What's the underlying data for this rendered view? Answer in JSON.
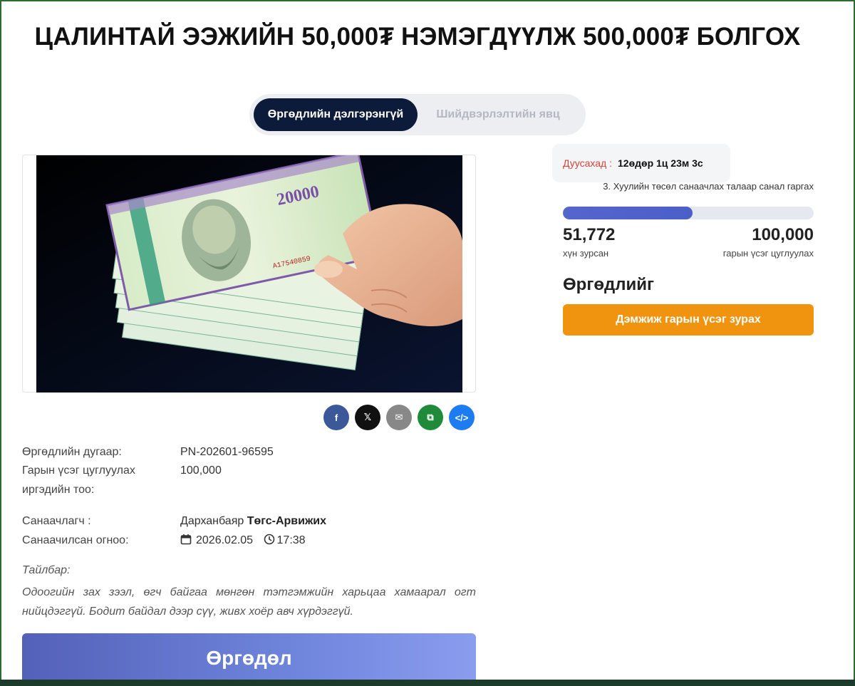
{
  "title": "ЦАЛИНТАЙ ЭЭЖИЙН 50,000₮ НЭМЭГДҮҮЛЖ 500,000₮ БОЛГОХ",
  "tabs": [
    {
      "label": "Өргөдлийн дэлгэрэнгүй",
      "active": true
    },
    {
      "label": "Шийдвэрлэлтийн явц",
      "active": false
    }
  ],
  "share": [
    "facebook-icon",
    "x-icon",
    "email-icon",
    "copy-icon",
    "embed-icon"
  ],
  "details": {
    "number_label": "Өргөдлийн дугаар:",
    "number_value": "PN-202601-96595",
    "target_label_line1": "Гарын үсэг цуглуулах",
    "target_label_line2": "иргэдийн тоо:",
    "target_value": "100,000",
    "author_label": "Санаачлагч :",
    "author_first": "Дарханбаяр",
    "author_last": "Төгс-Арвижих",
    "date_label": "Санаачилсан огноо:",
    "date_value": "2026.02.05",
    "time_value": "17:38"
  },
  "description": {
    "label": "Тайлбар:",
    "text": "Одоогийн зах зээл, өгч байгаа мөнгөн тэтгэмжийн харьцаа хамаарал огт нийцдэггүй. Бодит байдал дээр сүү, живх хоёр авч хүрдэггүй."
  },
  "bottom_button": "Өргөдөл",
  "countdown": {
    "label": "Дуусахад :",
    "value": "12өдөр 1ц 23м 3с"
  },
  "stage": "3. Хуулийн төсөл санаачлах талаар санал гаргах",
  "progress": {
    "fraction": 0.51772,
    "signed": "51,772",
    "signed_label": "хүн зурсан",
    "goal": "100,000",
    "goal_label": "гарын үсэг цуглуулах"
  },
  "petition_heading": "Өргөдлийг",
  "sign_button": "Дэмжиж гарын үсэг зурах",
  "colors": {
    "tab_active": "#0c1b3a",
    "accent_orange": "#f0930f",
    "progress_fill": "#5566cc",
    "countdown_red": "#d0443d"
  }
}
